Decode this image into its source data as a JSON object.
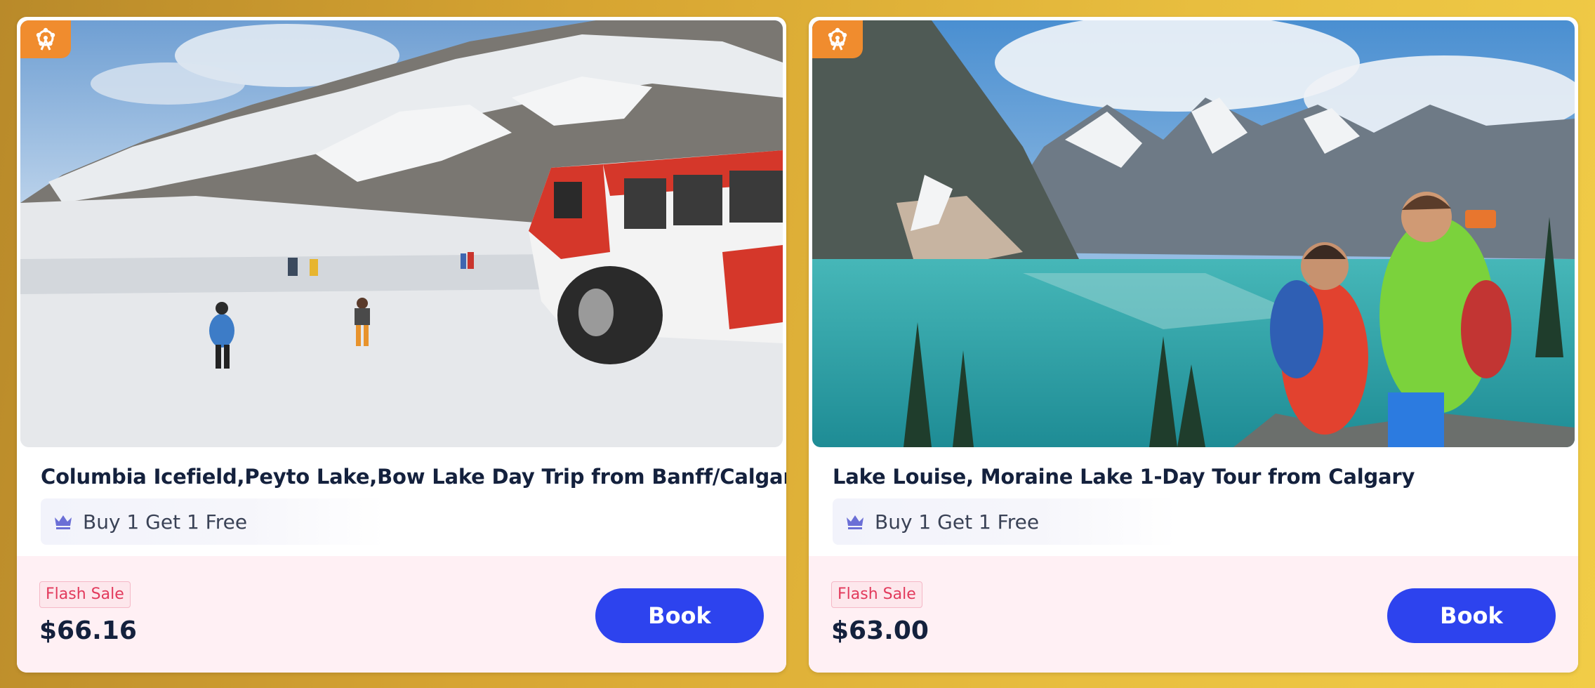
{
  "colors": {
    "accent_button": "#2d43ee",
    "badge_orange": "#f08c2e",
    "flash_red": "#e23a5c",
    "price_band": "#fff0f4",
    "title_navy": "#14213d"
  },
  "cards": [
    {
      "badge_icon": "ferris-wheel-icon",
      "image_alt": "Tourists walking on Columbia Icefield near a red ice explorer bus",
      "title": "Columbia Icefield,Peyto Lake,Bow Lake Day Trip from Banff/Calgary",
      "promo_icon": "crown-icon",
      "promo_label": "Buy 1 Get 1 Free",
      "flash_label": "Flash Sale",
      "price": "$66.16",
      "book_label": "Book"
    },
    {
      "badge_icon": "ferris-wheel-icon",
      "image_alt": "Couple taking a selfie above turquoise Moraine Lake",
      "title": "Lake Louise, Moraine Lake 1-Day Tour from Calgary",
      "promo_icon": "crown-icon",
      "promo_label": "Buy 1 Get 1 Free",
      "flash_label": "Flash Sale",
      "price": "$63.00",
      "book_label": "Book"
    }
  ]
}
